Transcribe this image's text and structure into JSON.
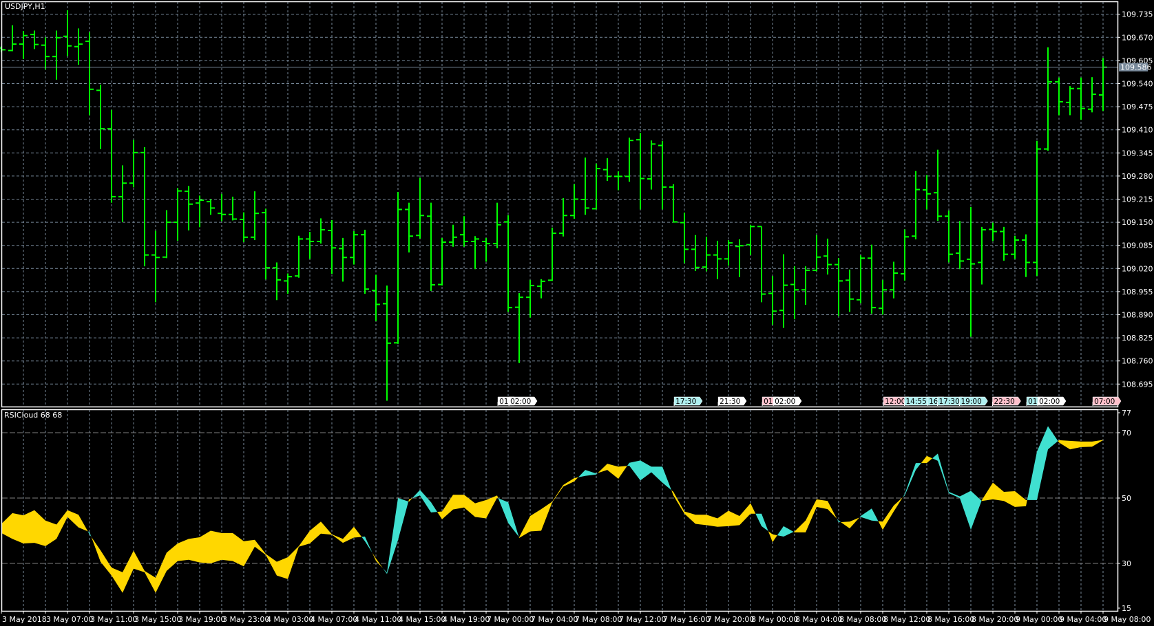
{
  "chart": {
    "symbol_title": "USDJPY,H1",
    "indicator_title": "RSICloud 68 68",
    "current_price": 109.586,
    "current_price_label": "109.586",
    "colors": {
      "background": "#000000",
      "bars": "#00ff00",
      "grid": "#778899",
      "frame": "#ffffff",
      "cloud_bearish": "#ffd700",
      "cloud_bullish": "#40e0d0",
      "price_line": "#778899"
    }
  },
  "price_axis": {
    "labels": [
      "109.735",
      "109.670",
      "109.605",
      "109.540",
      "109.475",
      "109.410",
      "109.345",
      "109.280",
      "109.215",
      "109.150",
      "109.085",
      "109.020",
      "108.955",
      "108.890",
      "108.825",
      "108.760",
      "108.695"
    ]
  },
  "rsi_axis": {
    "labels": [
      "77",
      "70",
      "50",
      "30",
      "15"
    ],
    "grid_levels": [
      70,
      50,
      30
    ],
    "range": [
      15,
      77
    ]
  },
  "time_axis": {
    "labels": [
      "3 May 2018",
      "3 May 07:00",
      "3 May 11:00",
      "3 May 15:00",
      "3 May 19:00",
      "3 May 23:00",
      "4 May 03:00",
      "4 May 07:00",
      "4 May 11:00",
      "4 May 15:00",
      "4 May 19:00",
      "7 May 00:00",
      "7 May 04:00",
      "7 May 08:00",
      "7 May 12:00",
      "7 May 16:00",
      "7 May 20:00",
      "8 May 00:00",
      "8 May 04:00",
      "8 May 08:00",
      "8 May 12:00",
      "8 May 16:00",
      "8 May 20:00",
      "9 May 00:00",
      "9 May 04:00",
      "9 May 08:00"
    ]
  },
  "event_markers": [
    {
      "bar": 45.1,
      "text": "01:",
      "color": "#ffffff"
    },
    {
      "bar": 46.1,
      "text": "02:00",
      "color": "#ffffff"
    },
    {
      "bar": 61.1,
      "text": "17:30",
      "color": "#afeeee"
    },
    {
      "bar": 65.1,
      "text": "21:30",
      "color": "#ffffff"
    },
    {
      "bar": 69.1,
      "text": "01:",
      "color": "#ffc0cb"
    },
    {
      "bar": 70.1,
      "text": "02:00",
      "color": "#ffffff"
    },
    {
      "bar": 80.1,
      "text": "12:00",
      "color": "#ffc0cb"
    },
    {
      "bar": 82.0,
      "text": "14:55",
      "color": "#afeeee"
    },
    {
      "bar": 84.1,
      "text": "16:",
      "color": "#afeeee"
    },
    {
      "bar": 85.0,
      "text": "17:30",
      "color": "#afeeee"
    },
    {
      "bar": 87.0,
      "text": "19:00",
      "color": "#afeeee"
    },
    {
      "bar": 90.0,
      "text": "22:30",
      "color": "#ffc0cb"
    },
    {
      "bar": 93.1,
      "text": "01:",
      "color": "#afeeee"
    },
    {
      "bar": 94.1,
      "text": "02:00",
      "color": "#ffffff"
    },
    {
      "bar": 99.1,
      "text": "07:00",
      "color": "#ffc0cb"
    }
  ],
  "chart_data": {
    "type": "ohlc",
    "title": "USDJPY,H1",
    "ylim": [
      108.6695,
      109.7655
    ],
    "ohlc_fields": [
      "open",
      "high",
      "low",
      "close"
    ],
    "ohlc": [
      [
        109.64,
        109.645,
        109.63,
        109.635
      ],
      [
        109.633,
        109.704,
        109.633,
        109.651
      ],
      [
        109.651,
        109.688,
        109.611,
        109.675
      ],
      [
        109.678,
        109.689,
        109.639,
        109.65
      ],
      [
        109.648,
        109.67,
        109.582,
        109.616
      ],
      [
        109.616,
        109.689,
        109.553,
        109.669
      ],
      [
        109.673,
        109.746,
        109.619,
        109.646
      ],
      [
        109.644,
        109.695,
        109.595,
        109.651
      ],
      [
        109.659,
        109.684,
        109.453,
        109.524
      ],
      [
        109.521,
        109.537,
        109.358,
        109.413
      ],
      [
        109.413,
        109.466,
        109.207,
        109.222
      ],
      [
        109.222,
        109.31,
        109.153,
        109.26
      ],
      [
        109.26,
        109.382,
        109.25,
        109.346
      ],
      [
        109.346,
        109.361,
        109.028,
        109.058
      ],
      [
        109.058,
        109.126,
        108.927,
        109.051
      ],
      [
        109.052,
        109.184,
        109.051,
        109.15
      ],
      [
        109.15,
        109.246,
        109.1,
        109.238
      ],
      [
        109.237,
        109.252,
        109.129,
        109.201
      ],
      [
        109.204,
        109.225,
        109.138,
        109.212
      ],
      [
        109.208,
        109.215,
        109.173,
        109.19
      ],
      [
        109.175,
        109.23,
        109.155,
        109.172
      ],
      [
        109.172,
        109.222,
        109.157,
        109.159
      ],
      [
        109.158,
        109.178,
        109.096,
        109.108
      ],
      [
        109.108,
        109.237,
        109.102,
        109.175
      ],
      [
        109.177,
        109.188,
        108.991,
        109.022
      ],
      [
        109.022,
        109.037,
        108.933,
        108.988
      ],
      [
        108.985,
        109.006,
        108.951,
        108.997
      ],
      [
        108.999,
        109.112,
        108.996,
        109.103
      ],
      [
        109.103,
        109.123,
        109.049,
        109.096
      ],
      [
        109.096,
        109.161,
        109.092,
        109.129
      ],
      [
        109.127,
        109.156,
        109.007,
        109.078
      ],
      [
        109.076,
        109.106,
        108.985,
        109.051
      ],
      [
        109.051,
        109.125,
        109.033,
        109.115
      ],
      [
        109.115,
        109.129,
        108.951,
        108.962
      ],
      [
        108.958,
        109.002,
        108.874,
        108.919
      ],
      [
        108.921,
        108.972,
        108.65,
        108.81
      ],
      [
        108.811,
        109.235,
        108.81,
        109.186
      ],
      [
        109.186,
        109.205,
        109.067,
        109.111
      ],
      [
        109.113,
        109.275,
        109.106,
        109.169
      ],
      [
        109.167,
        109.205,
        108.959,
        108.974
      ],
      [
        108.975,
        109.106,
        108.974,
        109.094
      ],
      [
        109.094,
        109.143,
        109.083,
        109.108
      ],
      [
        109.115,
        109.167,
        109.083,
        109.096
      ],
      [
        109.096,
        109.111,
        109.02,
        109.103
      ],
      [
        109.096,
        109.106,
        109.041,
        109.09
      ],
      [
        109.09,
        109.205,
        109.079,
        109.143
      ],
      [
        109.151,
        109.17,
        108.9,
        108.91
      ],
      [
        108.911,
        108.951,
        108.756,
        108.939
      ],
      [
        108.939,
        108.988,
        108.884,
        108.972
      ],
      [
        108.97,
        108.99,
        108.938,
        108.984
      ],
      [
        108.987,
        109.135,
        108.987,
        109.119
      ],
      [
        109.119,
        109.218,
        109.112,
        109.169
      ],
      [
        109.169,
        109.257,
        109.162,
        109.215
      ],
      [
        109.214,
        109.332,
        109.173,
        109.19
      ],
      [
        109.188,
        109.315,
        109.188,
        109.301
      ],
      [
        109.298,
        109.33,
        109.268,
        109.279
      ],
      [
        109.279,
        109.293,
        109.242,
        109.279
      ],
      [
        109.279,
        109.388,
        109.266,
        109.38
      ],
      [
        109.382,
        109.401,
        109.188,
        109.273
      ],
      [
        109.272,
        109.38,
        109.244,
        109.37
      ],
      [
        109.366,
        109.379,
        109.188,
        109.249
      ],
      [
        109.249,
        109.257,
        109.151,
        109.151
      ],
      [
        109.149,
        109.177,
        109.037,
        109.074
      ],
      [
        109.074,
        109.114,
        109.015,
        109.023
      ],
      [
        109.024,
        109.109,
        109.014,
        109.058
      ],
      [
        109.058,
        109.098,
        108.992,
        109.047
      ],
      [
        109.047,
        109.1,
        109.03,
        109.092
      ],
      [
        109.082,
        109.102,
        108.998,
        109.084
      ],
      [
        109.087,
        109.143,
        109.06,
        109.138
      ],
      [
        109.138,
        109.138,
        108.927,
        108.948
      ],
      [
        108.95,
        108.999,
        108.864,
        108.9
      ],
      [
        108.902,
        109.06,
        108.855,
        108.973
      ],
      [
        108.975,
        109.026,
        108.879,
        108.96
      ],
      [
        108.96,
        109.026,
        108.92,
        109.015
      ],
      [
        109.015,
        109.114,
        109.014,
        109.052
      ],
      [
        109.055,
        109.104,
        109.005,
        109.031
      ],
      [
        109.031,
        109.049,
        108.888,
        108.985
      ],
      [
        108.987,
        109.017,
        108.9,
        108.934
      ],
      [
        108.932,
        109.057,
        108.924,
        109.049
      ],
      [
        109.049,
        109.087,
        108.895,
        108.91
      ],
      [
        108.908,
        108.988,
        108.892,
        108.96
      ],
      [
        108.96,
        109.039,
        108.938,
        109.007
      ],
      [
        109.005,
        109.13,
        108.988,
        109.109
      ],
      [
        109.111,
        109.294,
        109.104,
        109.242
      ],
      [
        109.241,
        109.283,
        109.188,
        109.23
      ],
      [
        109.233,
        109.354,
        109.156,
        109.167
      ],
      [
        109.167,
        109.183,
        109.039,
        109.06
      ],
      [
        109.063,
        109.154,
        109.02,
        109.041
      ],
      [
        109.046,
        109.193,
        108.83,
        109.033
      ],
      [
        109.037,
        109.137,
        108.977,
        109.129
      ],
      [
        109.13,
        109.149,
        109.099,
        109.124
      ],
      [
        109.124,
        109.137,
        109.044,
        109.06
      ],
      [
        109.06,
        109.112,
        109.049,
        109.1
      ],
      [
        109.1,
        109.116,
        108.998,
        109.037
      ],
      [
        109.037,
        109.379,
        109.001,
        109.356
      ],
      [
        109.356,
        109.642,
        109.353,
        109.545
      ],
      [
        109.545,
        109.557,
        109.453,
        109.489
      ],
      [
        109.487,
        109.533,
        109.453,
        109.526
      ],
      [
        109.526,
        109.557,
        109.44,
        109.47
      ],
      [
        109.468,
        109.558,
        109.461,
        109.51
      ],
      [
        109.508,
        109.612,
        109.465,
        109.586
      ]
    ],
    "rsi_cloud": {
      "name": "RSICloud 68 68",
      "line_a": [
        42.1,
        45.4,
        44.7,
        46.3,
        43.1,
        41.9,
        46.3,
        44.9,
        38.9,
        34.0,
        28.7,
        27.3,
        33.9,
        27.7,
        25.6,
        33.3,
        36.1,
        37.5,
        38.0,
        40.0,
        39.3,
        39.3,
        36.8,
        37.2,
        32.9,
        30.5,
        31.9,
        35.3,
        40.0,
        42.8,
        38.9,
        37.5,
        41.2,
        36.8,
        31.5,
        26.8,
        37.1,
        49.6,
        50.8,
        45.6,
        45.9,
        51.0,
        51.0,
        48.4,
        49.4,
        50.8,
        42.4,
        38.0,
        44.5,
        46.6,
        48.9,
        54.0,
        56.1,
        56.8,
        57.2,
        60.5,
        59.6,
        59.9,
        55.4,
        57.9,
        54.7,
        51.9,
        45.9,
        44.9,
        44.9,
        43.8,
        46.1,
        44.5,
        48.4,
        41.4,
        38.9,
        38.2,
        39.8,
        43.1,
        49.6,
        49.1,
        42.6,
        42.8,
        44.2,
        43.1,
        42.8,
        47.7,
        50.8,
        58.6,
        62.9,
        61.4,
        51.5,
        50.0,
        40.3,
        49.4,
        54.7,
        51.9,
        52.1,
        49.4,
        49.4,
        64.9,
        67.7,
        67.5,
        67.3,
        67.3,
        67.8
      ],
      "line_b": [
        39.3,
        37.5,
        36.1,
        36.3,
        35.3,
        37.5,
        44.2,
        41.0,
        39.6,
        30.5,
        26.3,
        21.0,
        28.4,
        27.3,
        21.0,
        27.7,
        30.7,
        31.1,
        30.3,
        30.0,
        31.1,
        30.7,
        29.1,
        35.1,
        32.6,
        26.3,
        25.2,
        35.1,
        36.1,
        39.1,
        38.8,
        36.3,
        37.9,
        38.2,
        30.8,
        27.2,
        50.0,
        48.9,
        52.5,
        48.7,
        43.5,
        46.5,
        47.1,
        44.2,
        43.8,
        50.1,
        48.7,
        37.8,
        39.8,
        40.0,
        48.7,
        53.5,
        55.1,
        58.6,
        57.5,
        58.6,
        55.9,
        60.8,
        61.5,
        59.6,
        59.6,
        50.8,
        45.2,
        42.1,
        41.7,
        41.2,
        41.4,
        41.7,
        45.2,
        45.2,
        36.5,
        41.4,
        39.5,
        39.5,
        47.3,
        46.6,
        43.1,
        40.7,
        44.5,
        46.8,
        40.3,
        45.9,
        51.2,
        60.7,
        60.7,
        63.6,
        51.9,
        50.5,
        52.2,
        49.1,
        49.6,
        49.1,
        47.3,
        47.5,
        64.2,
        72.0,
        67.0,
        64.9,
        65.6,
        65.7,
        67.7
      ]
    }
  }
}
